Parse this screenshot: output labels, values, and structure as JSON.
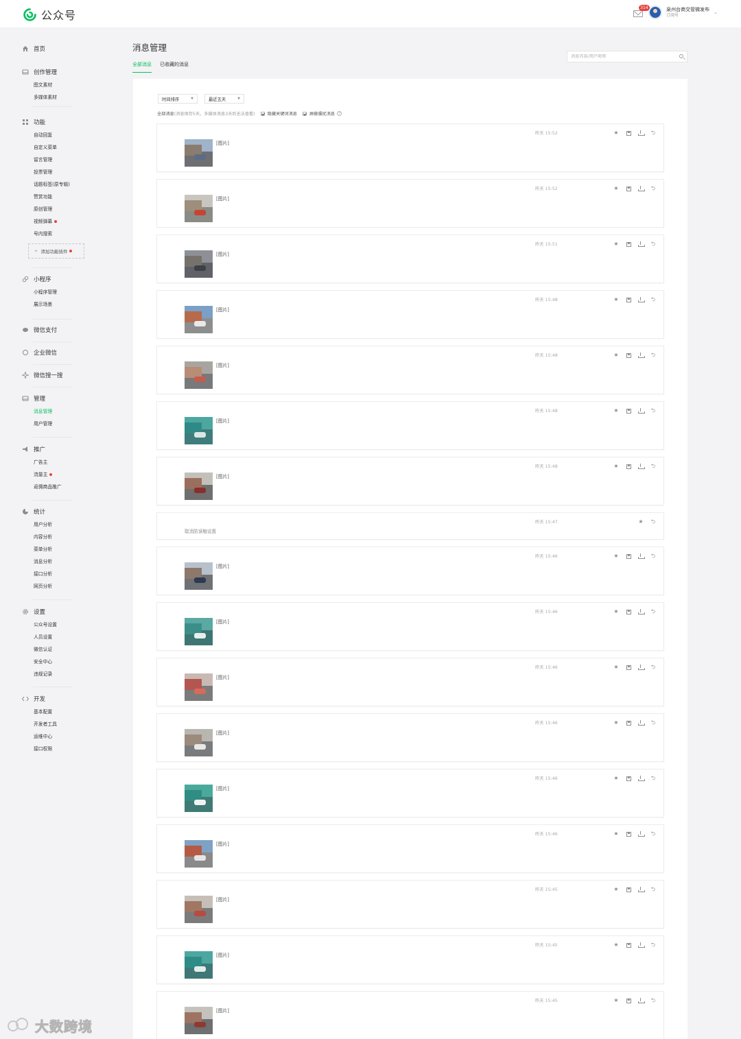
{
  "app": {
    "brand_name": "公众号",
    "brand_color": "#07c160"
  },
  "topbar": {
    "mail_badge": "314",
    "account_name": "泉州台商交管微发布",
    "account_type": "订阅号"
  },
  "sidebar": {
    "home": "首页",
    "sections": [
      {
        "title": "创作管理",
        "icon": "drawer-icon",
        "items": [
          {
            "label": "图文素材"
          },
          {
            "label": "多媒体素材"
          }
        ]
      },
      {
        "title": "功能",
        "icon": "grid-icon",
        "items": [
          {
            "label": "自动回复"
          },
          {
            "label": "自定义菜单"
          },
          {
            "label": "留言管理"
          },
          {
            "label": "投票管理"
          },
          {
            "label": "话题标签(原专辑)"
          },
          {
            "label": "赞赏功能"
          },
          {
            "label": "原创管理"
          },
          {
            "label": "视频弹幕",
            "dot": true
          },
          {
            "label": "号内搜索"
          }
        ],
        "add_plugin": "添加功能插件"
      },
      {
        "title": "小程序",
        "icon": "link-icon",
        "items": [
          {
            "label": "小程序管理"
          },
          {
            "label": "展示场景"
          }
        ]
      },
      {
        "title": "微信支付",
        "icon": "pay-icon",
        "items": []
      },
      {
        "title": "企业微信",
        "icon": "wecom-icon",
        "items": []
      },
      {
        "title": "微信搜一搜",
        "icon": "sparkle-icon",
        "items": []
      },
      {
        "title": "管理",
        "icon": "drawer-icon",
        "items": [
          {
            "label": "消息管理",
            "active": true
          },
          {
            "label": "用户管理"
          }
        ]
      },
      {
        "title": "推广",
        "icon": "megaphone-icon",
        "items": [
          {
            "label": "广告主"
          },
          {
            "label": "流量主",
            "dot": true
          },
          {
            "label": "返佣商品推广"
          }
        ]
      },
      {
        "title": "统计",
        "icon": "pie-icon",
        "items": [
          {
            "label": "用户分析"
          },
          {
            "label": "内容分析"
          },
          {
            "label": "菜单分析"
          },
          {
            "label": "消息分析"
          },
          {
            "label": "接口分析"
          },
          {
            "label": "网页分析"
          }
        ]
      },
      {
        "title": "设置",
        "icon": "gear-icon",
        "items": [
          {
            "label": "公众号设置"
          },
          {
            "label": "人员设置"
          },
          {
            "label": "微信认证"
          },
          {
            "label": "安全中心"
          },
          {
            "label": "违规记录"
          }
        ]
      },
      {
        "title": "开发",
        "icon": "code-icon",
        "items": [
          {
            "label": "基本配置"
          },
          {
            "label": "开发者工具"
          },
          {
            "label": "运维中心"
          },
          {
            "label": "接口权限"
          }
        ]
      }
    ]
  },
  "main": {
    "title": "消息管理",
    "tabs": [
      {
        "label": "全部消息",
        "active": true
      },
      {
        "label": "已收藏的消息"
      }
    ],
    "search_placeholder": "消息内容/用户昵称",
    "filters": {
      "sort": "时间排序",
      "range": "最近五天"
    },
    "info": {
      "prefix": "全部消息",
      "note": "(消息保存5天，多媒体消息3天后无法查看)",
      "hide_keyword": "隐藏关键词消息",
      "block_harass": "屏蔽骚扰消息"
    },
    "pic_label": "[图片]",
    "messages": [
      {
        "time": "昨天 15:52",
        "kind": "image",
        "palette": [
          "#9fb3c9",
          "#8a7c6e",
          "#6d6f73",
          "#5b6c85"
        ]
      },
      {
        "time": "昨天 15:52",
        "kind": "image",
        "palette": [
          "#c9c6c0",
          "#9d8f7b",
          "#8b8b86",
          "#c74334"
        ]
      },
      {
        "time": "昨天 15:51",
        "kind": "image",
        "palette": [
          "#8d9196",
          "#76726b",
          "#5f6266",
          "#3d4045"
        ]
      },
      {
        "time": "昨天 15:48",
        "kind": "image",
        "palette": [
          "#7aa0c6",
          "#b86a4c",
          "#8e8e8e",
          "#e9e9e9"
        ]
      },
      {
        "time": "昨天 15:48",
        "kind": "image",
        "palette": [
          "#a8a5a1",
          "#b98d75",
          "#77797b",
          "#c45c4e"
        ]
      },
      {
        "time": "昨天 15:48",
        "kind": "image",
        "palette": [
          "#4da7a1",
          "#2f8a87",
          "#3e7d7c",
          "#d9e7e3"
        ]
      },
      {
        "time": "昨天 15:48",
        "kind": "image",
        "palette": [
          "#c3c0bb",
          "#9b6f5d",
          "#6f6f6f",
          "#8b2d2a"
        ]
      },
      {
        "time": "昨天 15:47",
        "kind": "text",
        "text": "取消防误触设置"
      },
      {
        "time": "昨天 15:46",
        "kind": "image",
        "palette": [
          "#b7c1cc",
          "#8d786a",
          "#6f7174",
          "#2d3a52"
        ]
      },
      {
        "time": "昨天 15:46",
        "kind": "image",
        "palette": [
          "#5aa9a2",
          "#3b8f88",
          "#3d7673",
          "#e7efec"
        ]
      },
      {
        "time": "昨天 15:46",
        "kind": "image",
        "palette": [
          "#c9b9b4",
          "#b3564f",
          "#7b7b7b",
          "#d66a5c"
        ]
      },
      {
        "time": "昨天 15:46",
        "kind": "image",
        "palette": [
          "#b9b6b0",
          "#9c8a7c",
          "#7a7b7d",
          "#e8e8e8"
        ]
      },
      {
        "time": "昨天 15:46",
        "kind": "image",
        "palette": [
          "#4aa99d",
          "#2f8d83",
          "#3f7a74",
          "#f0f3f2"
        ]
      },
      {
        "time": "昨天 15:46",
        "kind": "image",
        "palette": [
          "#7ea2c4",
          "#b55a45",
          "#8a8a8a",
          "#e5e5e5"
        ]
      },
      {
        "time": "昨天 15:45",
        "kind": "image",
        "palette": [
          "#c6bfb8",
          "#a07763",
          "#7b7b7b",
          "#b84a3f"
        ]
      },
      {
        "time": "昨天 15:45",
        "kind": "image",
        "palette": [
          "#4da7a0",
          "#2e8c86",
          "#3f7877",
          "#e3ecea"
        ]
      },
      {
        "time": "昨天 15:45",
        "kind": "image",
        "palette": [
          "#c5c2bd",
          "#9d7463",
          "#6e6f70",
          "#8e3a33"
        ]
      }
    ]
  },
  "watermark": {
    "text": "大数跨境"
  }
}
